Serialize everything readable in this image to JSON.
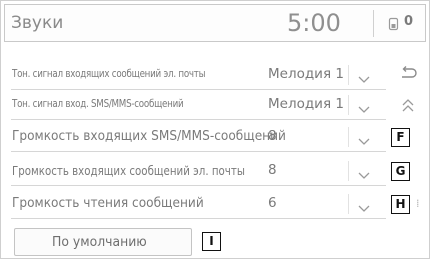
{
  "header": {
    "title": "Звуки",
    "clock": "5:00",
    "status_icon": "phone-battery-icon",
    "status_count": "0"
  },
  "rows": [
    {
      "label": "Тон. сигнал входящих сообщений эл. почты",
      "value": "Мелодия 1"
    },
    {
      "label": "Тон. сигнал вход. SMS/MMS-сообщений",
      "value": "Мелодия 1"
    },
    {
      "label": "Громкость входящих SMS/MMS-сообщений",
      "value": "8"
    },
    {
      "label": "Громкость входящих сообщений эл. почты",
      "value": "8"
    },
    {
      "label": "Громкость чтения сообщений",
      "value": "6"
    }
  ],
  "side": {
    "back_icon": "back-arrow-icon",
    "page_up_icon": "double-chevron-up-icon"
  },
  "callouts": {
    "f": "F",
    "g": "G",
    "h": "H",
    "i": "I"
  },
  "footer": {
    "default_label": "По умолчанию"
  },
  "colors": {
    "text": "#7a7a7a",
    "border": "#c9c9c9",
    "background": "#ffffff"
  }
}
